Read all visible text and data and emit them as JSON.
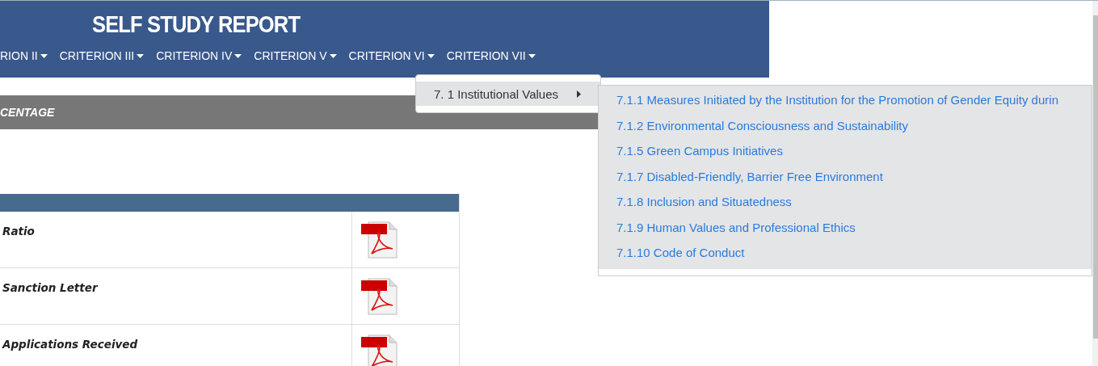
{
  "header": {
    "title": "SELF STUDY REPORT",
    "nav": [
      {
        "label": "RION II"
      },
      {
        "label": "CRITERION III"
      },
      {
        "label": "CRITERION IV"
      },
      {
        "label": "CRITERION V"
      },
      {
        "label": "CRITERION VI"
      },
      {
        "label": "CRITERION VII"
      }
    ]
  },
  "section_bar": {
    "title": "CENTAGE"
  },
  "table": {
    "rows": [
      {
        "label": "Ratio"
      },
      {
        "label": "Sanction Letter"
      },
      {
        "label": "Applications Received"
      }
    ]
  },
  "dropdown": {
    "items": [
      {
        "label": "7. 1 Institutional Values",
        "expanded": true
      }
    ]
  },
  "submenu": {
    "items": [
      {
        "label": "7.1.1 Measures Initiated by the Institution for the Promotion of Gender Equity durin"
      },
      {
        "label": "7.1.2 Environmental Consciousness and Sustainability"
      },
      {
        "label": "7.1.5 Green Campus Initiatives"
      },
      {
        "label": "7.1.7 Disabled-Friendly, Barrier Free Environment"
      },
      {
        "label": "7.1.8 Inclusion and Situatedness"
      },
      {
        "label": "7.1.9 Human Values and Professional Ethics"
      },
      {
        "label": "7.1.10 Code of Conduct"
      }
    ]
  }
}
